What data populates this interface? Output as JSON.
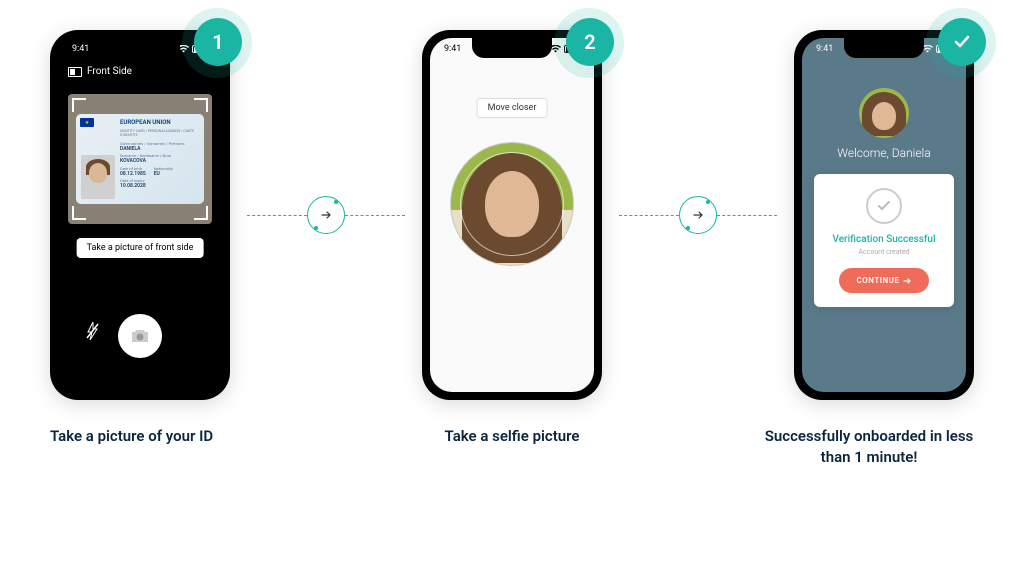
{
  "steps": {
    "s1": {
      "badge": "1",
      "time": "9:41",
      "header": "Front Side",
      "id_card": {
        "title": "EUROPEAN UNION",
        "subtitle": "IDENTITY CARD / PERSONALAUSWEIS / CARTE D'IDENTITE",
        "given_label": "Given names / Vornamen / Prénoms",
        "given": "DANIELA",
        "surname_label": "Surname / Nachname / Nom",
        "surname": "KOVACOVA",
        "dob_label": "Date of birth",
        "dob": "08.12.1985",
        "nat_label": "Nationality",
        "nat": "EU",
        "exp_label": "Date of expiry",
        "exp": "10.08.2028"
      },
      "instruction": "Take a picture of front side",
      "caption": "Take a picture of your ID"
    },
    "s2": {
      "badge": "2",
      "time": "9:41",
      "tip": "Move closer",
      "caption": "Take a selfie picture"
    },
    "s3": {
      "time": "9:41",
      "welcome": "Welcome, Daniela",
      "success_title": "Verification Successful",
      "success_sub": "Account created",
      "button": "CONTINUE",
      "caption": "Successfully onboarded in less than 1 minute!"
    }
  }
}
